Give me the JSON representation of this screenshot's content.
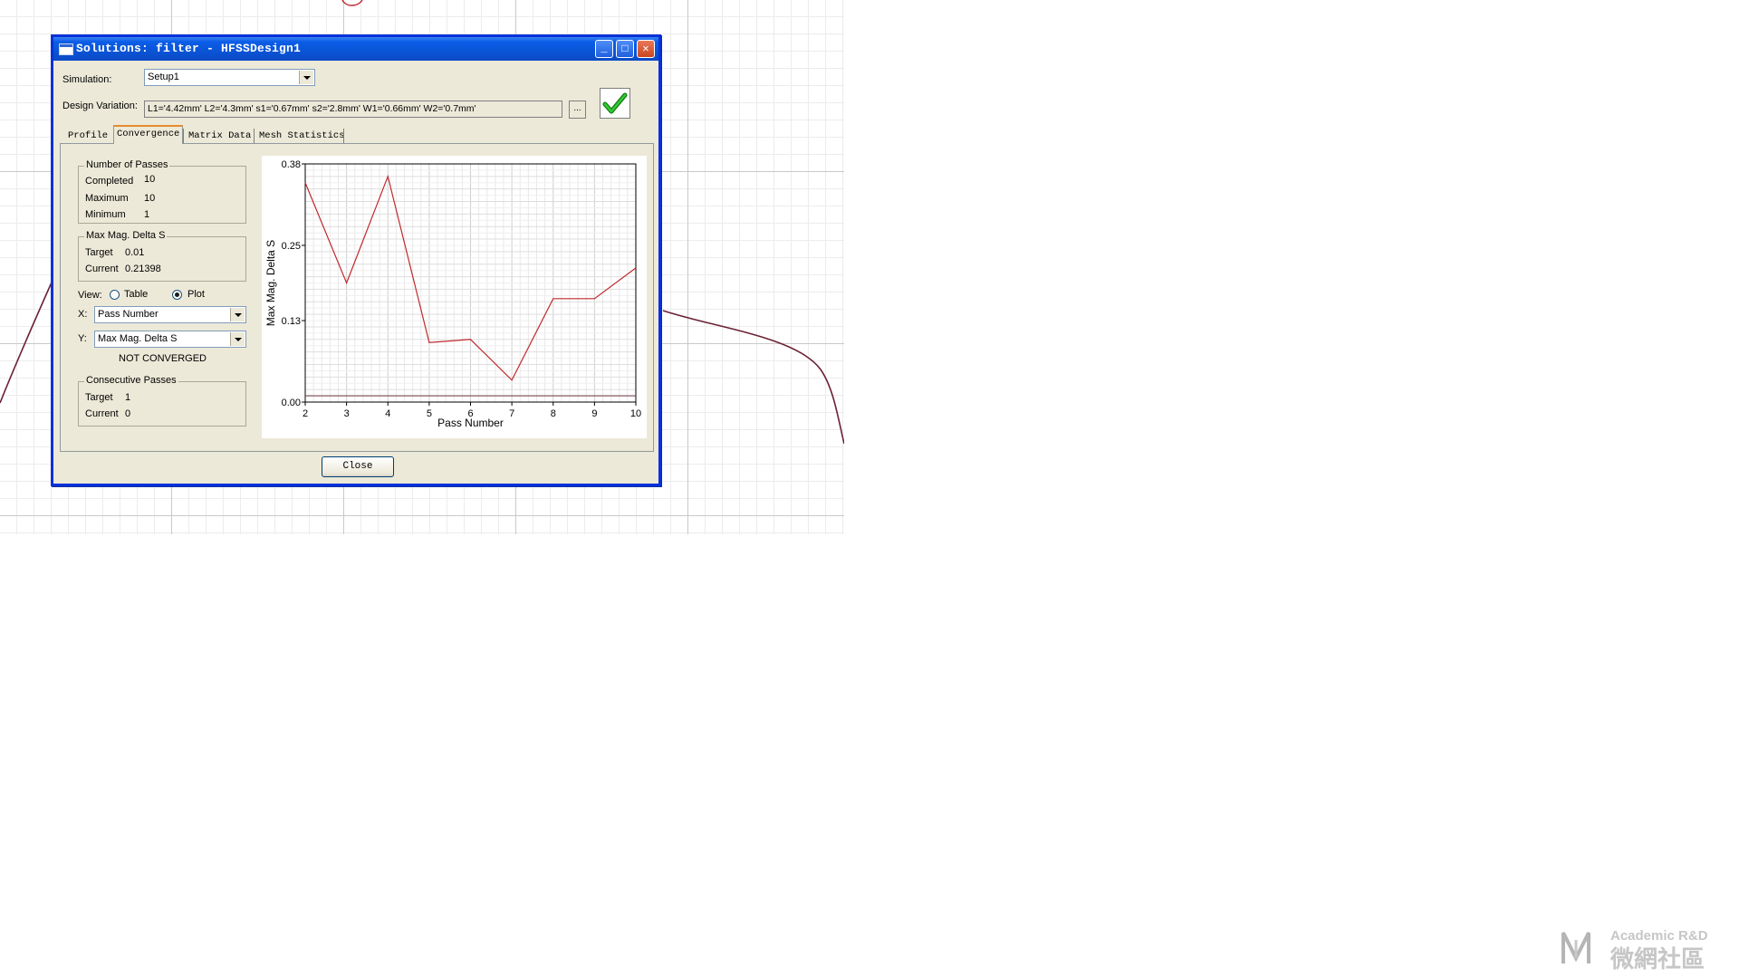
{
  "window": {
    "title": "Solutions: filter - HFSSDesign1",
    "minimize_symbol": "_",
    "maximize_symbol": "□",
    "close_symbol": "✕"
  },
  "simulation": {
    "label": "Simulation:",
    "selected": "Setup1"
  },
  "design_variation": {
    "label": "Design Variation:",
    "value": "L1='4.42mm' L2='4.3mm' s1='0.67mm' s2='2.8mm' W1='0.66mm' W2='0.7mm'",
    "browse_label": "..."
  },
  "status_icon": "check-icon",
  "tabs": [
    {
      "label": "Profile",
      "active": false
    },
    {
      "label": "Convergence",
      "active": true
    },
    {
      "label": "Matrix Data",
      "active": false
    },
    {
      "label": "Mesh Statistics",
      "active": false
    }
  ],
  "passes": {
    "group_title": "Number of Passes",
    "completed_label": "Completed",
    "completed": "10",
    "maximum_label": "Maximum",
    "maximum": "10",
    "minimum_label": "Minimum",
    "minimum": "1"
  },
  "delta": {
    "group_title": "Max Mag. Delta S",
    "target_label": "Target",
    "target": "0.01",
    "current_label": "Current",
    "current": "0.21398"
  },
  "view": {
    "label": "View:",
    "table_label": "Table",
    "plot_label": "Plot",
    "selected": "Plot"
  },
  "axes_select": {
    "x_label": "X:",
    "x_value": "Pass Number",
    "y_label": "Y:",
    "y_value": "Max Mag. Delta S"
  },
  "convergence_status": "NOT CONVERGED",
  "consecutive": {
    "group_title": "Consecutive Passes",
    "target_label": "Target",
    "target": "1",
    "current_label": "Current",
    "current": "0"
  },
  "close_label": "Close",
  "watermark": {
    "line1": "Academic R&D",
    "line2": "微網社區"
  },
  "chart_data": {
    "type": "line",
    "xlabel": "Pass Number",
    "ylabel": "Max Mag. Delta S",
    "xlim": [
      2,
      10
    ],
    "ylim": [
      0,
      0.38
    ],
    "xticks": [
      2,
      3,
      4,
      5,
      6,
      7,
      8,
      9,
      10
    ],
    "yticks": [
      "0.00",
      "0.13",
      "0.25",
      "0.38"
    ],
    "grid": true,
    "series": [
      {
        "color": "#c0282d",
        "x": [
          2,
          3,
          4,
          5,
          6,
          7,
          8,
          9,
          10
        ],
        "y": [
          0.35,
          0.19,
          0.36,
          0.095,
          0.1,
          0.035,
          0.165,
          0.165,
          0.214
        ]
      },
      {
        "color": "#7a4a52",
        "x": [
          2,
          10
        ],
        "y": [
          0.01,
          0.01
        ]
      }
    ]
  }
}
